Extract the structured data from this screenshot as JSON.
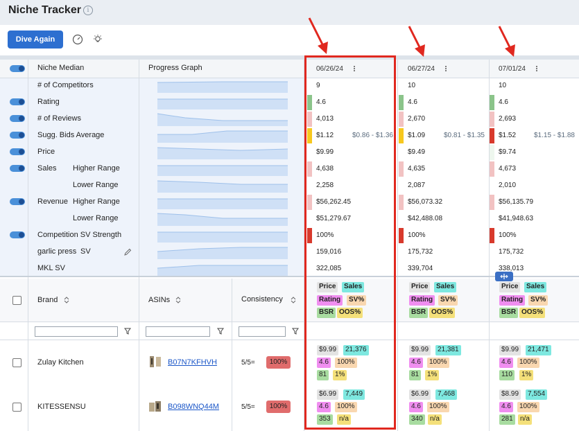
{
  "app": {
    "title": "Niche Tracker"
  },
  "toolbar": {
    "dive_label": "Dive Again"
  },
  "metrics_header": {
    "niche_median": "Niche Median",
    "progress_graph": "Progress Graph"
  },
  "dates": [
    "06/26/24",
    "06/27/24",
    "07/01/24"
  ],
  "metrics": [
    {
      "label": "# of Competitors",
      "values": [
        "9",
        "10",
        "10"
      ]
    },
    {
      "label": "Rating",
      "values": [
        "4.6",
        "4.6",
        "4.6"
      ]
    },
    {
      "label": "# of Reviews",
      "values": [
        "4,013",
        "2,670",
        "2,693"
      ]
    },
    {
      "label": "Sugg. Bids Average",
      "values": [
        "$1.12",
        "$1.09",
        "$1.52"
      ],
      "ranges": [
        "$0.86 - $1.36",
        "$0.81 - $1.35",
        "$1.15 - $1.88"
      ]
    },
    {
      "label": "Price",
      "values": [
        "$9.99",
        "$9.49",
        "$9.74"
      ]
    },
    {
      "label": "Sales",
      "sublabel": "Higher Range",
      "values": [
        "4,638",
        "4,635",
        "4,673"
      ]
    },
    {
      "sublabel": "Lower Range",
      "values": [
        "2,258",
        "2,087",
        "2,010"
      ]
    },
    {
      "label": "Revenue",
      "sublabel": "Higher Range",
      "values": [
        "$56,262.45",
        "$56,073.32",
        "$56,135.79"
      ]
    },
    {
      "sublabel": "Lower Range",
      "values": [
        "$51,279.67",
        "$42,488.08",
        "$41,948.63"
      ]
    },
    {
      "label": "Competition SV Strength",
      "values": [
        "100%",
        "100%",
        "100%"
      ]
    },
    {
      "label": "garlic press",
      "sublabel": "SV",
      "values": [
        "159,016",
        "175,732",
        "175,732"
      ]
    },
    {
      "label": "MKL SV",
      "values": [
        "322,085",
        "339,704",
        "338,013"
      ]
    }
  ],
  "table_header": {
    "brand": "Brand",
    "asins": "ASINs",
    "consistency": "Consistency"
  },
  "legend_chips": {
    "price": "Price",
    "sales": "Sales",
    "rating": "Rating",
    "sv": "SV%",
    "bsr": "BSR",
    "oos": "OOS%"
  },
  "rows": [
    {
      "brand": "Zulay Kitchen",
      "asin": "B07N7KFHVH",
      "consistency": "5/5=",
      "pct": "100%",
      "cells": [
        {
          "price": "$9.99",
          "sales": "21,376",
          "rating": "4.6",
          "sv": "100%",
          "bsr": "81",
          "oos": "1%"
        },
        {
          "price": "$9.99",
          "sales": "21,381",
          "rating": "4.6",
          "sv": "100%",
          "bsr": "81",
          "oos": "1%"
        },
        {
          "price": "$9.99",
          "sales": "21,471",
          "rating": "4.6",
          "sv": "100%",
          "bsr": "110",
          "oos": "1%"
        }
      ]
    },
    {
      "brand": "KITESSENSU",
      "asin": "B098WNQ44M",
      "consistency": "5/5=",
      "pct": "100%",
      "cells": [
        {
          "price": "$6.99",
          "sales": "7,449",
          "rating": "4.6",
          "sv": "100%",
          "bsr": "353",
          "oos": "n/a"
        },
        {
          "price": "$6.99",
          "sales": "7,468",
          "rating": "4.6",
          "sv": "100%",
          "bsr": "340",
          "oos": "n/a"
        },
        {
          "price": "$8.99",
          "sales": "7,554",
          "rating": "4.6",
          "sv": "100%",
          "bsr": "281",
          "oos": "n/a"
        }
      ]
    }
  ],
  "colors": {
    "price_chip": "#e3e3e3",
    "sales_chip": "#7ee8e0",
    "rating_chip": "#f08ef0",
    "sv_chip": "#f9d7b0",
    "bsr_chip": "#a8dca0",
    "oos_chip": "#f4e07a",
    "indicator_green": "#8bc48a",
    "indicator_pink": "#f2c2c2",
    "indicator_yellow": "#f7c81e",
    "indicator_red": "#d83a2c",
    "highlight": "#e0281f",
    "primary": "#2d6fd0"
  }
}
